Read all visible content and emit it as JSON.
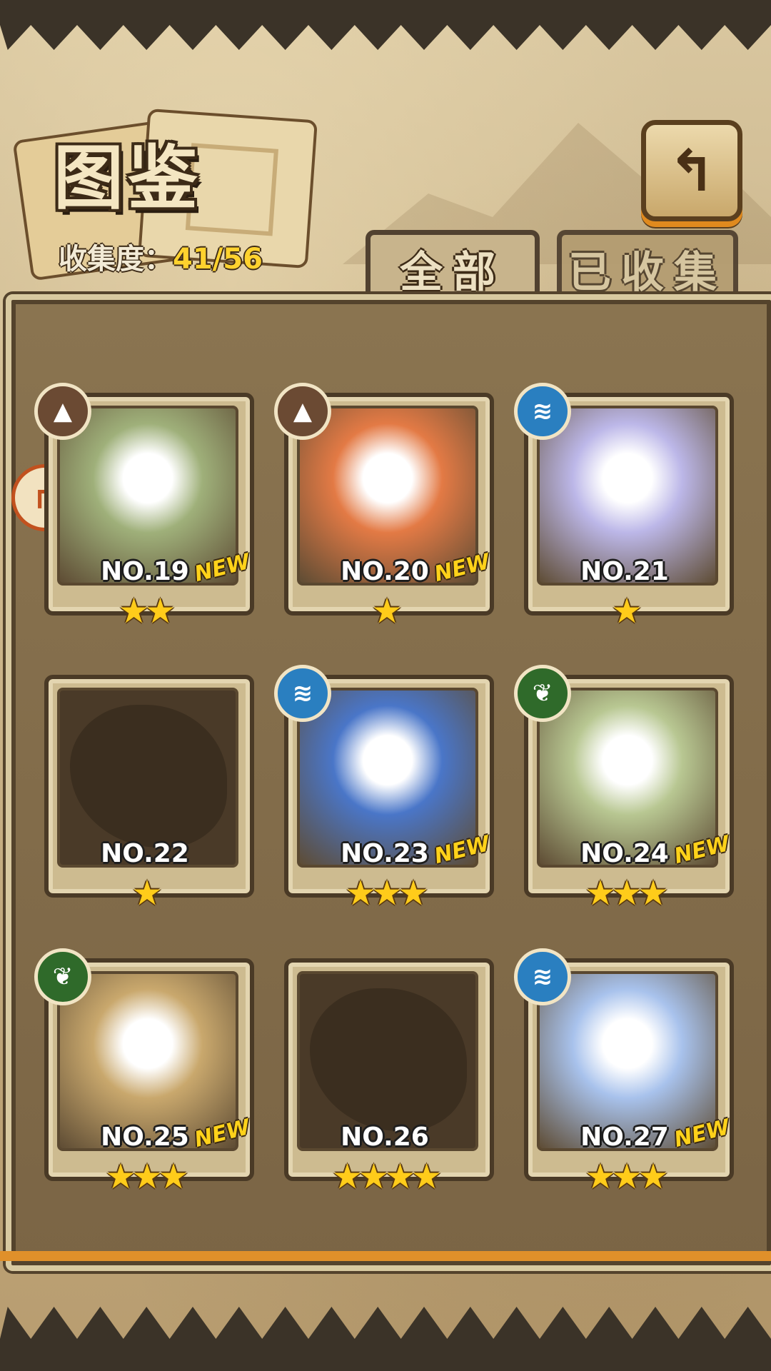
{
  "header": {
    "title": "图鉴",
    "collection_label": "收集度：",
    "collection_value": "41/56",
    "back_icon": "return-arrow-icon"
  },
  "tabs": [
    {
      "label": "全部",
      "active": true
    },
    {
      "label": "已收集",
      "active": false
    }
  ],
  "colors": {
    "earth": "#6b4a33",
    "water": "#2a7fc0",
    "wood": "#2f6a2a",
    "new_badge": "#ffd21a",
    "collect_value": "#ffd22e"
  },
  "cards": [
    {
      "num": "NO.19",
      "stars": "★★",
      "new": "NEW",
      "element": "earth-icon",
      "art": "#9fb07a"
    },
    {
      "num": "NO.20",
      "stars": "★",
      "new": "NEW",
      "element": "earth-icon",
      "art": "#e37a45"
    },
    {
      "num": "NO.21",
      "stars": "★",
      "new": "",
      "element": "water-icon",
      "art": "#bcb7e8"
    },
    {
      "num": "NO.22",
      "stars": "★",
      "new": "",
      "element": "",
      "art": "silhouette"
    },
    {
      "num": "NO.23",
      "stars": "★★★",
      "new": "NEW",
      "element": "water-icon",
      "art": "#4a76c8"
    },
    {
      "num": "NO.24",
      "stars": "★★★",
      "new": "NEW",
      "element": "wood-icon",
      "art": "#b8c792"
    },
    {
      "num": "NO.25",
      "stars": "★★★",
      "new": "NEW",
      "element": "wood-icon",
      "art": "#c9a86d"
    },
    {
      "num": "NO.26",
      "stars": "★★★★",
      "new": "",
      "element": "",
      "art": "silhouette"
    },
    {
      "num": "NO.27",
      "stars": "★★★",
      "new": "NEW",
      "element": "water-icon",
      "art": "#a8c2ec"
    }
  ]
}
